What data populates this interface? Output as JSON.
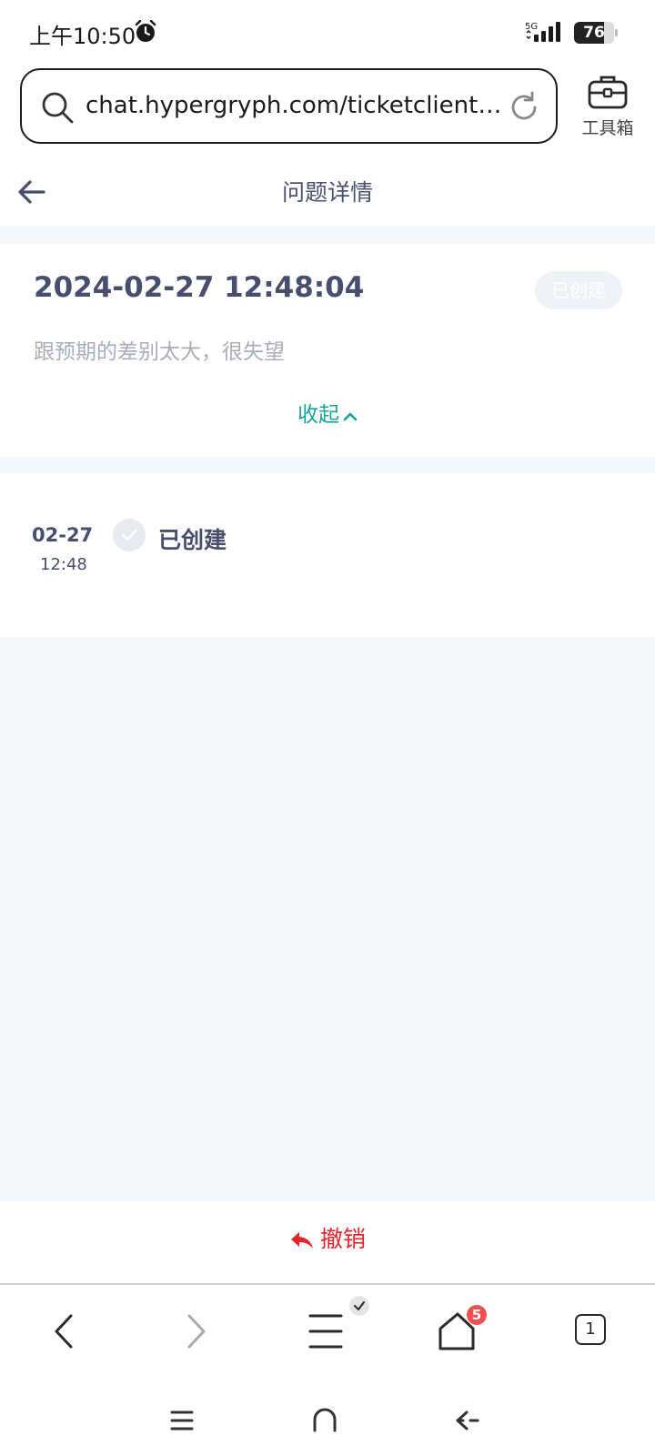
{
  "status_bar": {
    "time": "上午10:50",
    "network": "5G",
    "battery": "76",
    "battery_level": 0.76
  },
  "url_bar": {
    "url": "chat.hypergryph.com/ticketclient…",
    "toolbox_label": "工具箱"
  },
  "page": {
    "title": "问题详情"
  },
  "ticket": {
    "datetime": "2024-02-27 12:48:04",
    "status": "已创建",
    "description": "跟预期的差别太大，很失望",
    "collapse_label": "收起"
  },
  "timeline": [
    {
      "date": "02-27",
      "time": "12:48",
      "label": "已创建"
    }
  ],
  "revoke": {
    "label": "撤销"
  },
  "browser_nav": {
    "home_badge": "5",
    "tab_count": "1"
  },
  "colors": {
    "accent": "#17a39a",
    "danger": "#e4242b",
    "text_primary": "#474e6e",
    "text_muted": "#a9adb9"
  }
}
